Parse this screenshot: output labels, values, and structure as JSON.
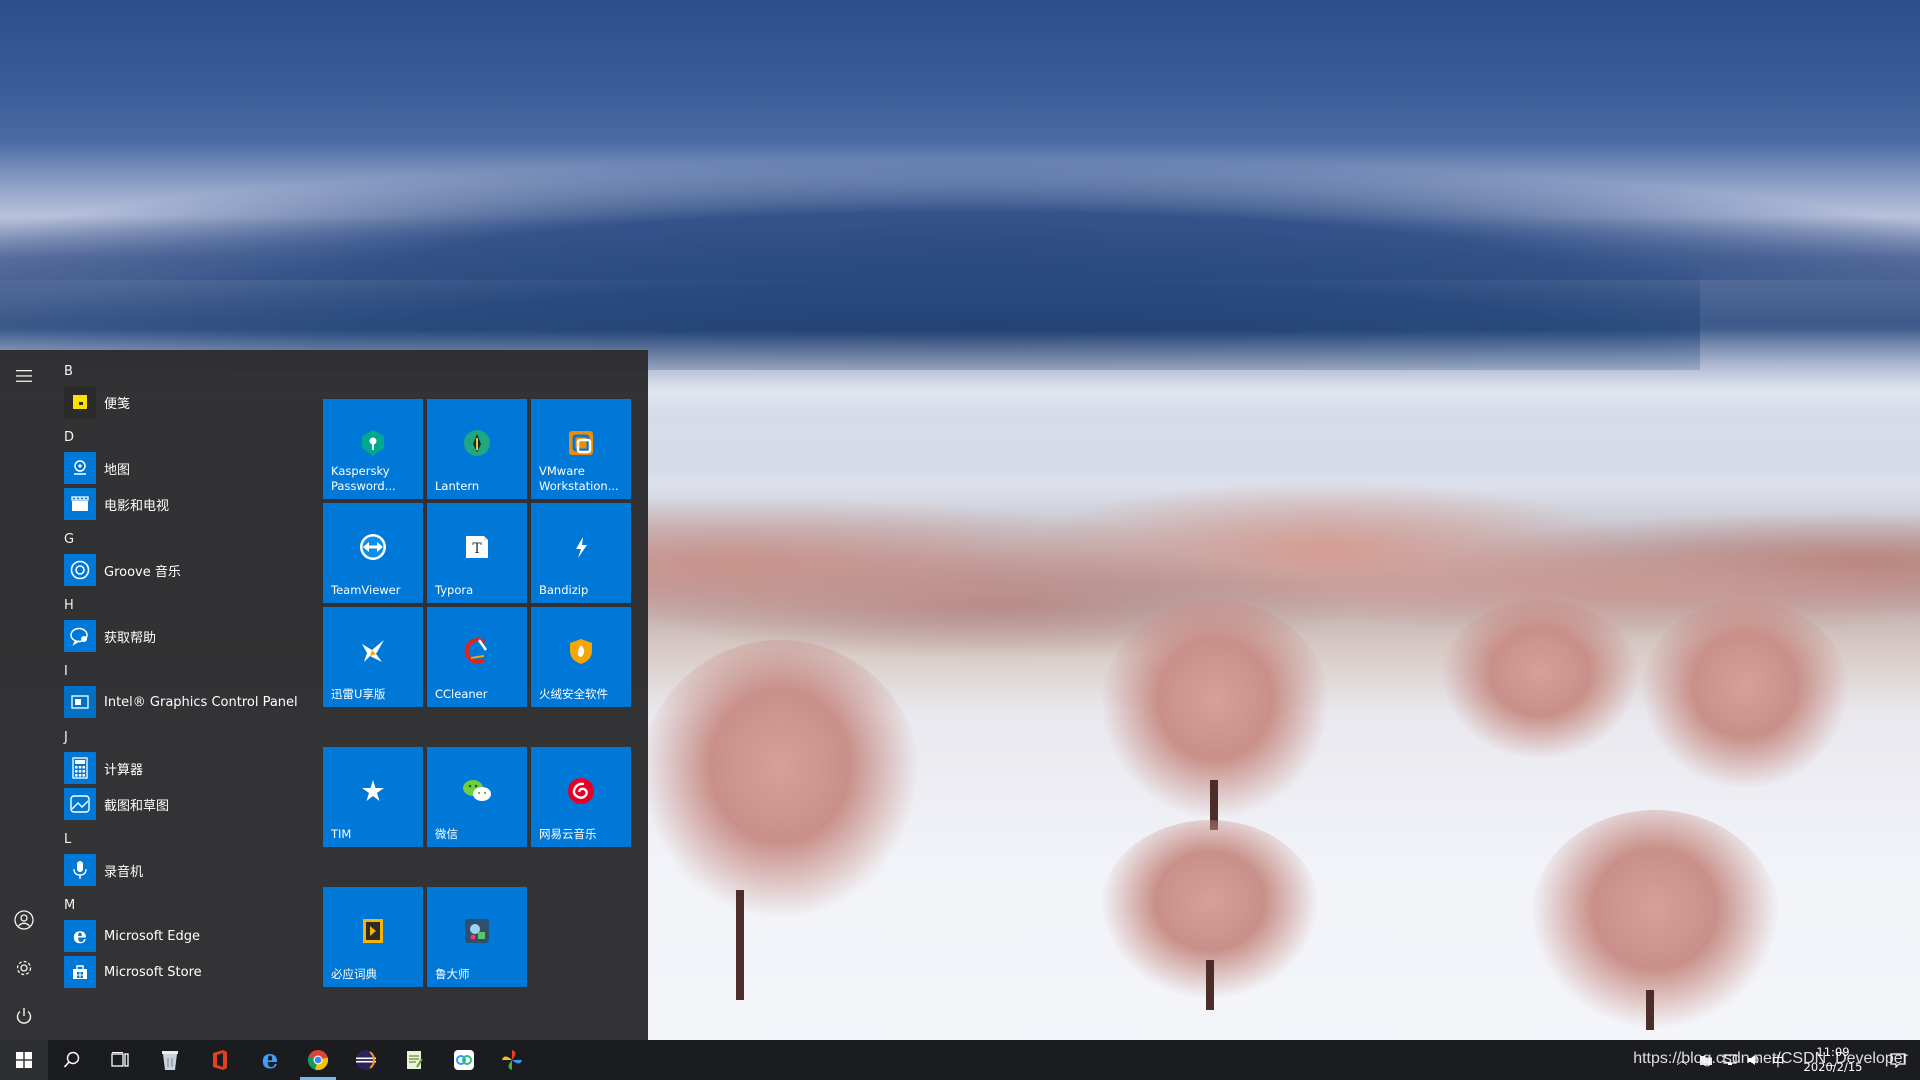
{
  "start_menu": {
    "rail": {
      "expand_icon": "hamburger-icon",
      "account_icon": "user-icon",
      "settings_icon": "gear-icon",
      "power_icon": "power-icon"
    },
    "app_groups": [
      {
        "letter": "B",
        "apps": [
          {
            "label": "便笺",
            "icon": "sticky-notes-icon"
          }
        ]
      },
      {
        "letter": "D",
        "apps": [
          {
            "label": "地图",
            "icon": "maps-icon"
          },
          {
            "label": "电影和电视",
            "icon": "movies-tv-icon"
          }
        ]
      },
      {
        "letter": "G",
        "apps": [
          {
            "label": "Groove 音乐",
            "icon": "groove-music-icon"
          }
        ]
      },
      {
        "letter": "H",
        "apps": [
          {
            "label": "获取帮助",
            "icon": "get-help-icon"
          }
        ]
      },
      {
        "letter": "I",
        "apps": [
          {
            "label": "Intel® Graphics Control Panel",
            "icon": "intel-graphics-icon"
          }
        ]
      },
      {
        "letter": "J",
        "apps": [
          {
            "label": "计算器",
            "icon": "calculator-icon"
          },
          {
            "label": "截图和草图",
            "icon": "snip-sketch-icon"
          }
        ]
      },
      {
        "letter": "L",
        "apps": [
          {
            "label": "录音机",
            "icon": "voice-recorder-icon"
          }
        ]
      },
      {
        "letter": "M",
        "apps": [
          {
            "label": "Microsoft Edge",
            "icon": "edge-icon"
          },
          {
            "label": "Microsoft Store",
            "icon": "store-icon"
          }
        ]
      }
    ],
    "tiles": [
      {
        "label": "Kaspersky Password...",
        "icon": "kaspersky-icon"
      },
      {
        "label": "Lantern",
        "icon": "lantern-icon"
      },
      {
        "label": "VMware Workstation...",
        "icon": "vmware-icon"
      },
      {
        "label": "TeamViewer",
        "icon": "teamviewer-icon"
      },
      {
        "label": "Typora",
        "icon": "typora-icon"
      },
      {
        "label": "Bandizip",
        "icon": "bandizip-icon"
      },
      {
        "label": "迅雷U享版",
        "icon": "xunlei-icon"
      },
      {
        "label": "CCleaner",
        "icon": "ccleaner-icon"
      },
      {
        "label": "火绒安全软件",
        "icon": "huorong-icon"
      },
      {
        "label": "TIM",
        "icon": "tim-icon"
      },
      {
        "label": "微信",
        "icon": "wechat-icon"
      },
      {
        "label": "网易云音乐",
        "icon": "netease-music-icon"
      },
      {
        "label": "必应词典",
        "icon": "bing-dict-icon"
      },
      {
        "label": "鲁大师",
        "icon": "ludashi-icon"
      }
    ],
    "tile_color": "#0078d7"
  },
  "taskbar": {
    "pinned": [
      "windows-start-icon",
      "search-icon",
      "task-view-icon",
      "recycle-bin-icon",
      "office-icon",
      "edge-icon",
      "chrome-icon",
      "eclipse-icon",
      "notepad-icon",
      "baidu-netdisk-icon",
      "pinwheel-app-icon"
    ],
    "clock": {
      "time": "11:09",
      "date": "2020/2/15"
    },
    "tray_ime": "中"
  },
  "watermark": "https://blog.csdn.net/CSDN_Developer"
}
